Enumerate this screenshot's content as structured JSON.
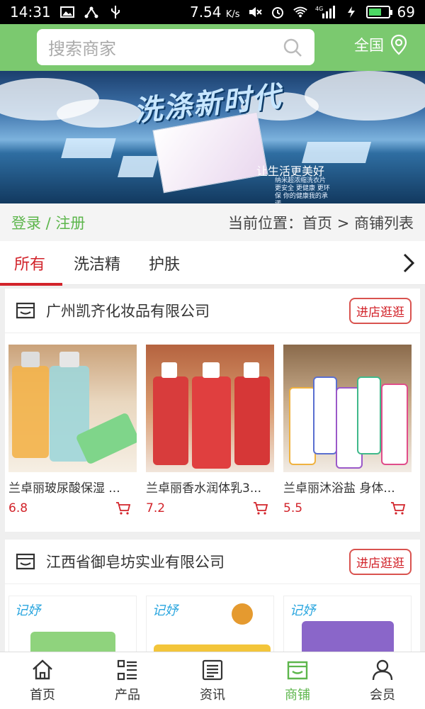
{
  "status": {
    "time": "14:31",
    "speed": "7.54",
    "speed_unit": "K/s",
    "network": "4G",
    "battery": "69",
    "battery_level": 0.69
  },
  "header": {
    "search_placeholder": "搜索商家",
    "region": "全国"
  },
  "banner": {
    "headline": "洗涤新时代",
    "slogan": "让生活更美好",
    "sub": "纳米超浓缩洗衣片 更安全 更健康 更环保 你的健康我的承诺"
  },
  "location": {
    "login": "登录 / 注册",
    "crumb": "当前位置：首页 > 商铺列表"
  },
  "tabs": [
    {
      "label": "所有"
    },
    {
      "label": "洗洁精"
    },
    {
      "label": "护肤"
    }
  ],
  "shops": [
    {
      "name": "广州凯齐化妆品有限公司",
      "enter": "进店逛逛",
      "products": [
        {
          "title": "兰卓丽玻尿酸保湿 ...",
          "price": "6.8"
        },
        {
          "title": "兰卓丽香水润体乳3...",
          "price": "7.2"
        },
        {
          "title": "兰卓丽沐浴盐 身体...",
          "price": "5.5"
        }
      ]
    },
    {
      "name": "江西省御皂坊实业有限公司",
      "enter": "进店逛逛",
      "products": [
        {
          "brand": "记妤"
        },
        {
          "brand": "记妤"
        },
        {
          "brand": "记妤"
        }
      ]
    }
  ],
  "bottom_nav": [
    {
      "label": "首页",
      "icon": "home-icon"
    },
    {
      "label": "产品",
      "icon": "grid-list-icon"
    },
    {
      "label": "资讯",
      "icon": "news-icon"
    },
    {
      "label": "商铺",
      "icon": "store-icon"
    },
    {
      "label": "会员",
      "icon": "user-icon"
    }
  ],
  "colors": {
    "accent_green": "#7bc96f",
    "active_red": "#d2232a",
    "nav_active": "#5db64c"
  }
}
